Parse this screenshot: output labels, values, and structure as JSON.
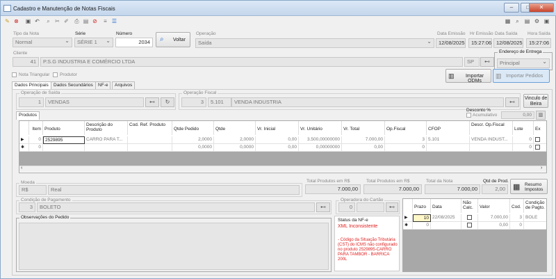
{
  "window": {
    "title": "Cadastro e Manutenção de Notas Fiscais"
  },
  "header": {
    "tipo_nota_label": "Tipo da Nota",
    "tipo_nota": "Normal",
    "serie_label": "Série",
    "serie": "SÉRIE 1",
    "numero_label": "Número",
    "numero": "2034",
    "voltar": "Voltar",
    "operacao_label": "Operação",
    "operacao": "Saída",
    "data_emissao_label": "Data Emissão",
    "data_emissao": "12/08/2025",
    "hr_emissao_label": "Hr Emissão",
    "hr_emissao": "15:27:06",
    "data_saida_label": "Data Saída",
    "data_saida": "12/08/2025",
    "hora_saida_label": "Hora Saída",
    "hora_saida": "15:27:06"
  },
  "cliente": {
    "label": "Cliente",
    "codigo": "41",
    "nome": "P.S.G INDUSTRIA E COMÉRCIO LTDA",
    "uf": "SP",
    "endereco_label": "Endereço de Entrega",
    "endereco": "Principal",
    "nota_triangular": "Nota Triangular",
    "produtor": "Produtor",
    "importar_odms": "Importar ODMs",
    "importar_pedidos": "Importar Pedidos"
  },
  "tabs": [
    "Dados Principais",
    "Dados Secundários",
    "NF-e",
    "Arquivos"
  ],
  "operacao_saida": {
    "label": "Operação de Saída",
    "codigo": "1",
    "nome": "VENDAS"
  },
  "operacao_fiscal": {
    "label": "Operação Fiscal",
    "codigo": "3",
    "cfop": "5.101",
    "nome": "VENDA INDUSTRIA"
  },
  "vinculo_beira": "Vinculo de Beira",
  "produtos_tab": "Produtos",
  "desconto": {
    "label": "Desconto %",
    "acumulativo": "Acumulativo",
    "valor": "0,00"
  },
  "grid": {
    "headers": [
      "Item",
      "Produto",
      "Descrição do Produto",
      "Cod. Ref. Produto",
      "Qtde Pedido",
      "Qtde",
      "Vr. Inicial",
      "Vr. Unitário",
      "Vr. Total",
      "Op.Fiscal",
      "CFOP",
      "Descr. Op.Fiscal",
      "Lote",
      "Ex"
    ],
    "rows": [
      [
        "0",
        "2529895",
        "CARRO PARA T...",
        "",
        "2,0000",
        "2,0000",
        "0,00",
        "3.500,00000000",
        "7.000,00",
        "3",
        "5.101",
        "VENDA INDUST...",
        "0"
      ],
      [
        "0",
        "",
        "",
        "",
        "0,0000",
        "0,0000",
        "0,00",
        "0,00000000",
        "0,00",
        "0",
        "",
        "",
        "0"
      ]
    ]
  },
  "moeda": {
    "label": "Moeda",
    "simbolo": "R$",
    "nome": "Real"
  },
  "totais": {
    "total_prod_label": "Total Produtos em R$",
    "total_prod": "7.000,00",
    "total_prod_rs_label": "Total Produtos em R$",
    "total_prod_rs": "7.000,00",
    "total_nota_label": "Total da Nota",
    "total_nota": "7.000,00",
    "qtd_prod_label": "Qtd de Prod.",
    "qtd_prod": "2,00",
    "resumo": "Resumo Impostos"
  },
  "pagamento": {
    "label": "Condição de Pagamento",
    "codigo": "3",
    "nome": "BOLETO"
  },
  "operadora": {
    "label": "Operadora do Cartão",
    "codigo": "0"
  },
  "observacoes_label": "Observações do Pedido",
  "status_nfe": {
    "label": "Status da NF-e",
    "status": "XML Inconsistente",
    "mensagem": "- Código da Situação Tributária (CST) do ICMS não configurado no produto 2529895-CARRO PARA TAMBOR - BARRICA 200L"
  },
  "parcelas": {
    "headers": [
      "Prazo",
      "Data",
      "Não Calc.",
      "Valor",
      "Cod.",
      "Condição de Pagto."
    ],
    "rows": [
      [
        "10",
        "22/08/2025",
        "",
        "7.000,00",
        "3",
        "BOLE"
      ],
      [
        "0",
        "",
        "",
        "0,00",
        "0",
        ""
      ]
    ]
  }
}
